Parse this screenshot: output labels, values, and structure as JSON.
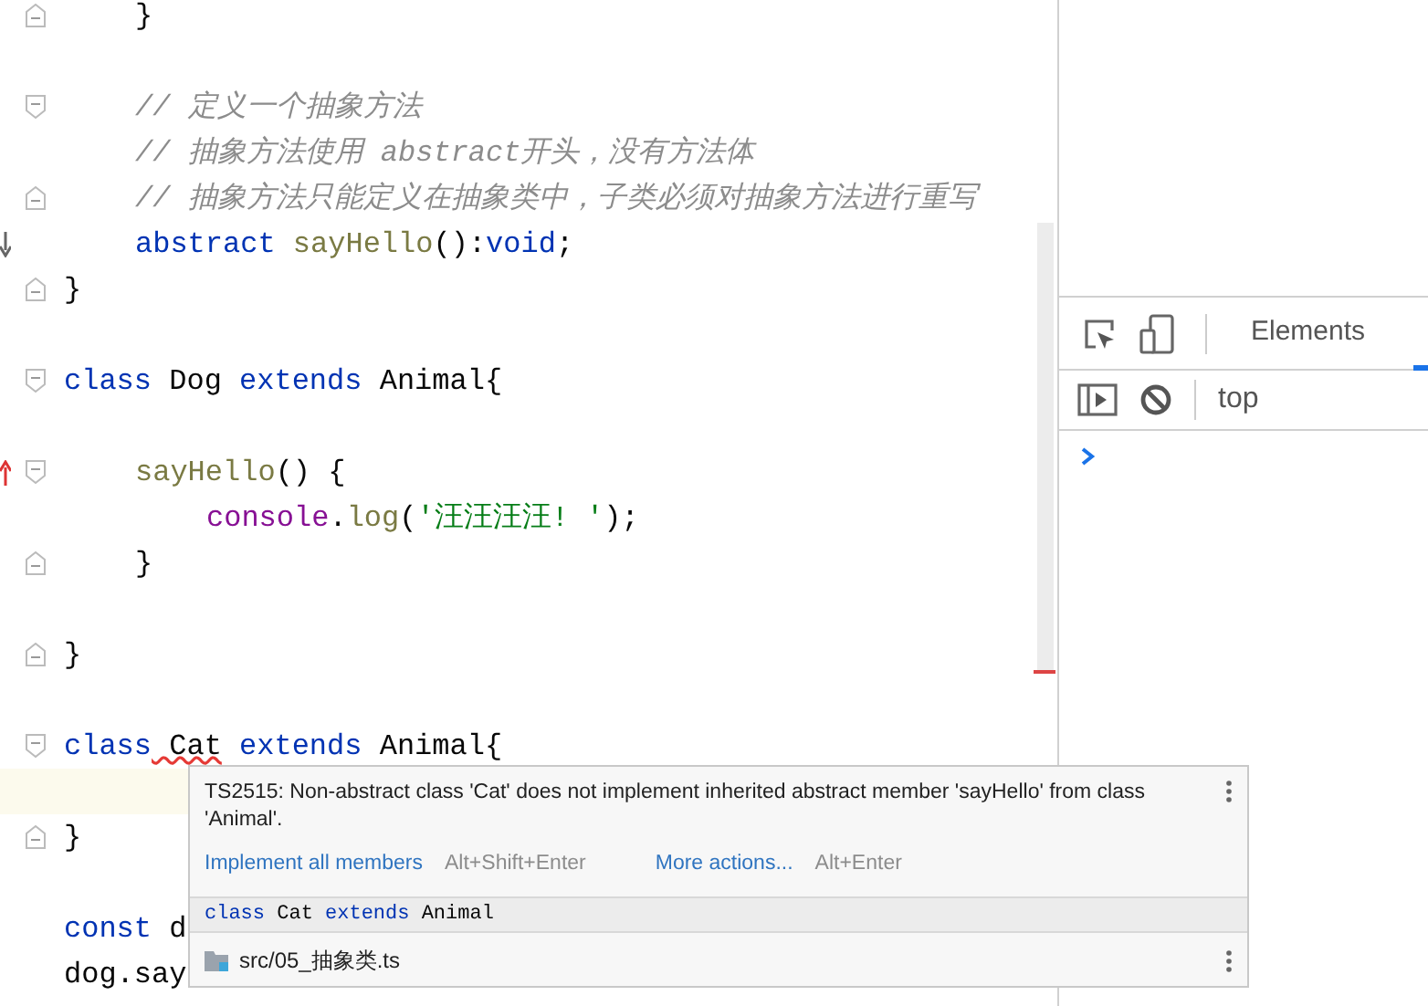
{
  "editor": {
    "lines": [
      {
        "kind": "group",
        "children": [
          {
            "kind": "code",
            "fold_close": true,
            "tokens": [
              {
                "kind": "plain",
                "text": "}"
              }
            ]
          },
          {
            "kind": "blank"
          },
          {
            "kind": "code",
            "fold_open": true,
            "tokens": [
              {
                "kind": "comment",
                "text": "// 定义一个抽象方法"
              }
            ]
          },
          {
            "kind": "code",
            "tokens": [
              {
                "kind": "comment",
                "text": "// 抽象方法使用 abstract开头，没有方法体"
              }
            ]
          },
          {
            "kind": "code",
            "fold_close": true,
            "tokens": [
              {
                "kind": "comment",
                "text": "// 抽象方法只能定义在抽象类中，子类必须对抽象方法进行重写"
              }
            ]
          },
          {
            "kind": "code",
            "implemented": true,
            "tokens": [
              {
                "kind": "keyword",
                "text": "abstract"
              },
              {
                "kind": "function",
                "text": " sayHello"
              },
              {
                "kind": "plain",
                "text": "():"
              },
              {
                "kind": "keyword",
                "text": "void"
              },
              {
                "kind": "plain",
                "text": ";"
              }
            ]
          }
        ]
      },
      {
        "kind": "code",
        "fold_close": true,
        "tokens": [
          {
            "kind": "plain",
            "text": "}"
          }
        ]
      },
      {
        "kind": "blank"
      },
      {
        "kind": "code",
        "fold_open": true,
        "tokens": [
          {
            "kind": "keyword",
            "text": "class"
          },
          {
            "kind": "plain",
            "text": " Dog"
          },
          {
            "kind": "keyword",
            "text": " extends"
          },
          {
            "kind": "plain",
            "text": " Animal{"
          }
        ],
        "children": [
          {
            "kind": "blank"
          },
          {
            "kind": "code",
            "fold_open": true,
            "overrides": true,
            "tokens": [
              {
                "kind": "function",
                "text": "sayHello"
              },
              {
                "kind": "plain",
                "text": "() {"
              }
            ],
            "children": [
              {
                "kind": "code",
                "tokens": [
                  {
                    "kind": "member",
                    "text": "console"
                  },
                  {
                    "kind": "plain",
                    "text": "."
                  },
                  {
                    "kind": "function",
                    "text": "log"
                  },
                  {
                    "kind": "plain",
                    "text": "("
                  },
                  {
                    "kind": "string",
                    "text": "'汪汪汪汪! '"
                  },
                  {
                    "kind": "plain",
                    "text": ");"
                  }
                ]
              }
            ]
          },
          {
            "kind": "code",
            "fold_close": true,
            "tokens": [
              {
                "kind": "plain",
                "text": "}"
              }
            ]
          },
          {
            "kind": "blank"
          }
        ]
      },
      {
        "kind": "code",
        "fold_close": true,
        "tokens": [
          {
            "kind": "plain",
            "text": "}"
          }
        ]
      },
      {
        "kind": "blank"
      },
      {
        "kind": "code",
        "fold_open": true,
        "tokens": [
          {
            "kind": "keyword",
            "text": "class"
          },
          {
            "kind": "error",
            "text": " Cat"
          },
          {
            "kind": "keyword",
            "text": " extends"
          },
          {
            "kind": "plain",
            "text": " Animal{"
          }
        ],
        "children": [
          {
            "kind": "blank",
            "current": true
          }
        ]
      },
      {
        "kind": "code",
        "fold_close": true,
        "tokens": [
          {
            "kind": "plain",
            "text": "}"
          }
        ]
      },
      {
        "kind": "blank"
      },
      {
        "kind": "code",
        "tokens": [
          {
            "kind": "keyword",
            "text": "const"
          },
          {
            "kind": "plain",
            "text": " d"
          }
        ]
      },
      {
        "kind": "code",
        "tokens": [
          {
            "kind": "plain",
            "text": "dog.say"
          }
        ]
      }
    ]
  },
  "popup": {
    "message": "TS2515: Non-abstract class 'Cat' does not implement inherited abstract member 'sayHello' from class 'Animal'.",
    "actions": [
      {
        "label": "Implement all members",
        "shortcut": "Alt+Shift+Enter"
      },
      {
        "label": "More actions...",
        "shortcut": "Alt+Enter"
      }
    ],
    "code": [
      {
        "kind": "keyword",
        "text": "class"
      },
      {
        "kind": "plain",
        "text": " Cat"
      },
      {
        "kind": "keyword",
        "text": " extends"
      },
      {
        "kind": "plain",
        "text": " Animal"
      }
    ],
    "file": "src/05_抽象类.ts"
  },
  "devtools": {
    "tabs": [
      {
        "label": "Elements",
        "selected": false
      }
    ],
    "context": "top"
  }
}
